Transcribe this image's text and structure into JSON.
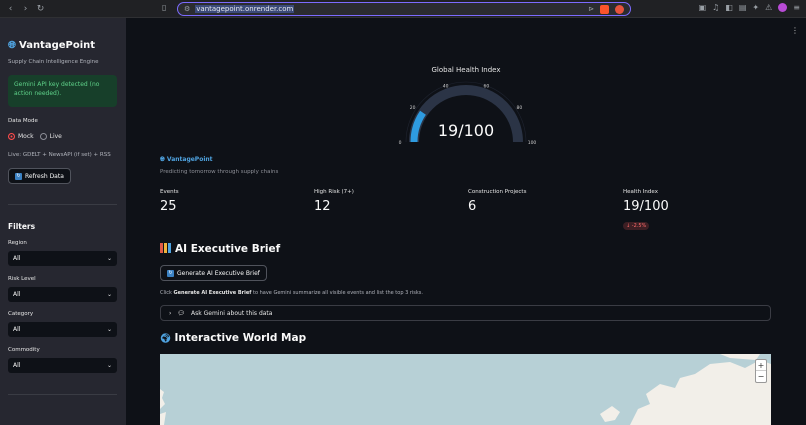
{
  "browser": {
    "url": "vantagepoint.onrender.com"
  },
  "sidebar": {
    "brand": "VantagePoint",
    "tagline": "Supply Chain Intelligence Engine",
    "alert": "Gemini API key detected (no action needed).",
    "data_mode_label": "Data Mode",
    "modes": [
      {
        "label": "Mock",
        "selected": true
      },
      {
        "label": "Live",
        "selected": false
      }
    ],
    "source": "Live: GDELT + NewsAPI (if set) + RSS",
    "refresh_label": "Refresh Data",
    "filters_title": "Filters",
    "filters": [
      {
        "label": "Region",
        "value": "All"
      },
      {
        "label": "Risk Level",
        "value": "All"
      },
      {
        "label": "Category",
        "value": "All"
      },
      {
        "label": "Commodity",
        "value": "All"
      }
    ]
  },
  "gauge": {
    "title": "Global Health Index",
    "value": 19,
    "max": 100,
    "display": "19/100",
    "ticks": [
      "0",
      "20",
      "40",
      "60",
      "80",
      "100"
    ]
  },
  "header": {
    "brand_small": "VantagePoint",
    "subtitle": "Predicting tomorrow through supply chains"
  },
  "metrics": [
    {
      "label": "Events",
      "value": "25"
    },
    {
      "label": "High Risk (7+)",
      "value": "12"
    },
    {
      "label": "Construction Projects",
      "value": "6"
    },
    {
      "label": "Health Index",
      "value": "19/100",
      "delta": "-2.5%"
    }
  ],
  "brief": {
    "title": "AI Executive Brief",
    "button": "Generate AI Executive Brief",
    "note_pre": "Click ",
    "note_bold": "Generate AI Executive Brief",
    "note_post": " to have Gemini summarize all visible events and list the top 3 risks.",
    "expander": "Ask Gemini about this data"
  },
  "map": {
    "title": "Interactive World Map",
    "zoom_in": "+",
    "zoom_out": "−"
  },
  "colors": {
    "accent": "#ff4b4b",
    "gauge_fill": "#2e9be0",
    "link_blue": "#4fa3e0"
  }
}
